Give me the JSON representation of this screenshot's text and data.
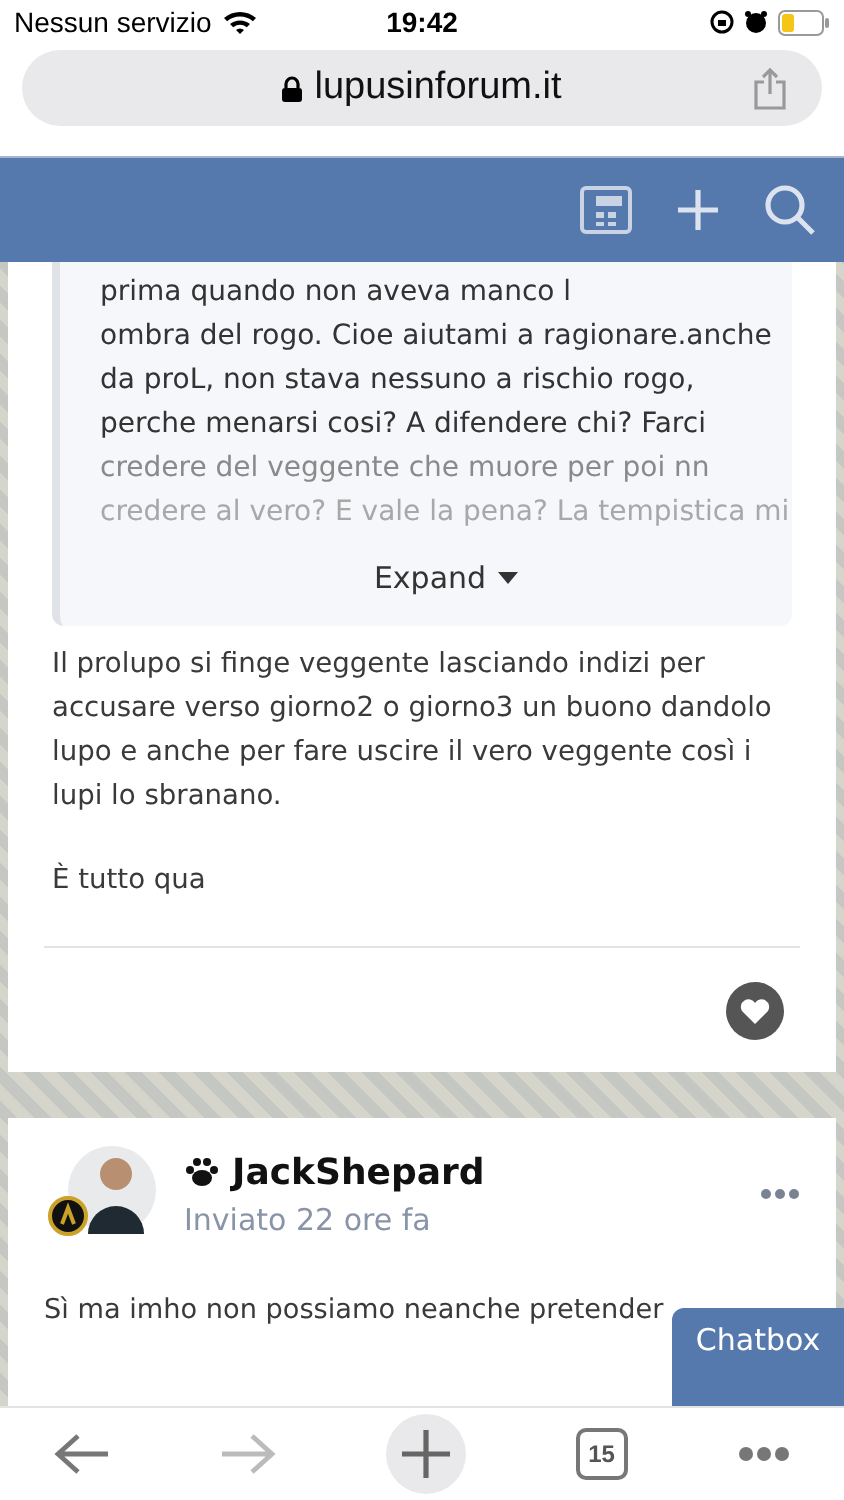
{
  "status_bar": {
    "carrier": "Nessun servizio",
    "time": "19:42"
  },
  "address_bar": {
    "url": "lupusinforum.it"
  },
  "quote": {
    "lines": [
      "prima quando non aveva manco l",
      "ombra del rogo. Cioe aiutami a ragionare.anche",
      "da proL, non stava nessuno a rischio rogo,",
      "perche menarsi cosi? A difendere chi? Farci",
      "credere del veggente che muore per poi nn",
      "credere al vero? E vale la pena? La tempistica mi"
    ],
    "expand_label": "Expand"
  },
  "post": {
    "paragraphs": [
      "Il prolupo si finge veggente lasciando indizi per accusare verso giorno2 o giorno3 un buono dandolo lupo e anche per fare uscire il vero veggente così i lupi lo sbranano.",
      "È tutto qua"
    ]
  },
  "next_post": {
    "author": "JackShepard",
    "time": "Inviato 22 ore fa",
    "text": "Sì ma imho non possiamo neanche pretender"
  },
  "chatbox": {
    "label": "Chatbox"
  },
  "toolbar": {
    "tab_count": "15"
  }
}
